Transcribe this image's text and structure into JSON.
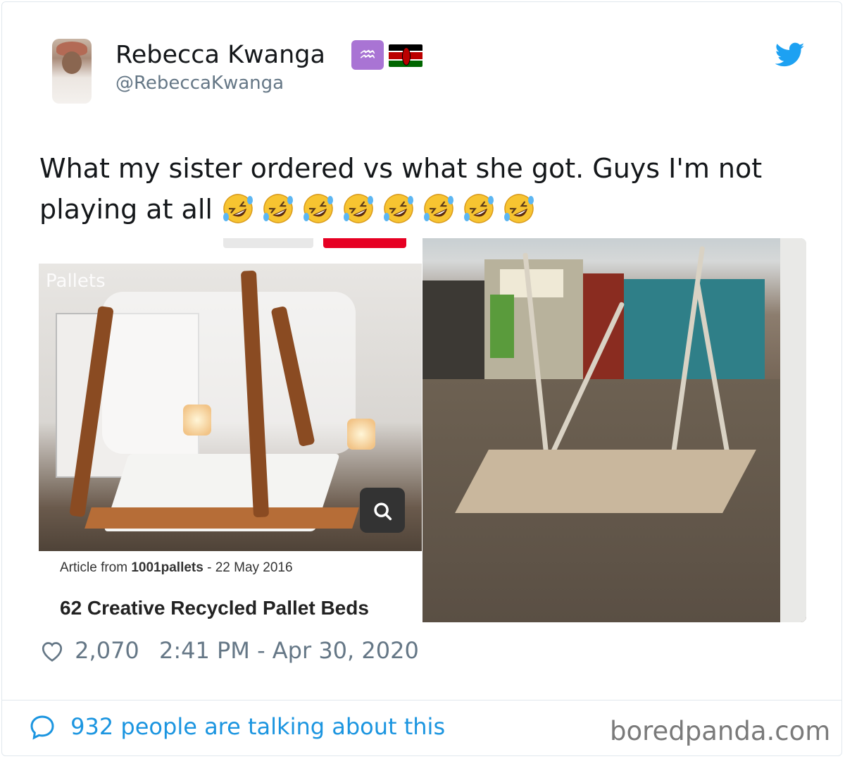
{
  "tweet": {
    "display_name": "Rebecca Kwanga",
    "badge_symbol": "♒",
    "handle": "@RebeccaKwanga",
    "text": "What my sister ordered vs what she got. Guys I'm not playing at all",
    "emoji": [
      "🤣",
      "🤣",
      "🤣",
      "🤣",
      "🤣",
      "🤣",
      "🤣",
      "🤣"
    ],
    "likes": "2,070",
    "timestamp": "2:41 PM - Apr 30, 2020",
    "conversation_link": "932 people are talking about this"
  },
  "left_image": {
    "watermark": "Pallets",
    "source_prefix": "Article from",
    "source_name": "1001pallets",
    "source_date": "- 22 May 2016",
    "title": "62 Creative Recycled Pallet Beds"
  },
  "footer": {
    "brand": "boredpanda.com"
  },
  "icons": {
    "bird": "twitter-bird-icon",
    "heart": "heart-icon",
    "bubble": "chat-bubble-icon",
    "lens": "visual-search-icon"
  },
  "colors": {
    "twitter_blue": "#1da1f2",
    "link_blue": "#1b95e0",
    "muted_gray": "#657786",
    "aquarius_purple": "#a974d4",
    "pinterest_red": "#e60023"
  }
}
